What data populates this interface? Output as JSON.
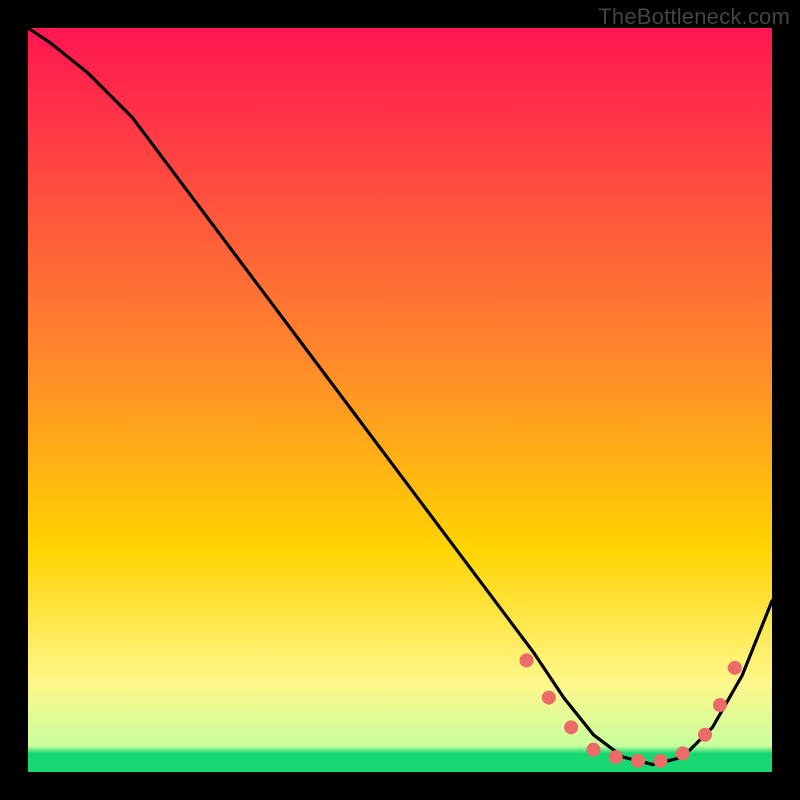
{
  "watermark": "TheBottleneck.com",
  "colors": {
    "frame": "#000000",
    "curve": "#000000",
    "dots": "#ec6b66",
    "bottom_band": "#17d773",
    "grad_top": "#ff1551",
    "grad_mid": "#ffd400",
    "grad_low": "#fff78a"
  },
  "chart_data": {
    "type": "line",
    "title": "",
    "xlabel": "",
    "ylabel": "",
    "xlim": [
      0,
      100
    ],
    "ylim": [
      0,
      100
    ],
    "grid": false,
    "legend": false,
    "series": [
      {
        "name": "curve",
        "x": [
          0,
          3,
          8,
          14,
          20,
          26,
          32,
          38,
          44,
          50,
          56,
          62,
          68,
          72,
          76,
          80,
          84,
          88,
          92,
          96,
          100
        ],
        "y": [
          100,
          98,
          94,
          88,
          80,
          72,
          64,
          56,
          48,
          40,
          32,
          24,
          16,
          10,
          5,
          2,
          1,
          2,
          6,
          13,
          23
        ]
      }
    ],
    "marker_points": {
      "name": "beads",
      "x": [
        67,
        70,
        73,
        76,
        79,
        82,
        85,
        88,
        91,
        93,
        95
      ],
      "y": [
        15,
        10,
        6,
        3,
        2,
        1.5,
        1.5,
        2.5,
        5,
        9,
        14
      ]
    },
    "background": {
      "type": "vertical-gradient",
      "stops": [
        {
          "pos": 0.0,
          "color": "#ff1551"
        },
        {
          "pos": 0.45,
          "color": "#ff8a2a"
        },
        {
          "pos": 0.7,
          "color": "#ffd400"
        },
        {
          "pos": 0.88,
          "color": "#fff78a"
        },
        {
          "pos": 0.965,
          "color": "#c9ff9e"
        },
        {
          "pos": 0.975,
          "color": "#17d773"
        },
        {
          "pos": 1.0,
          "color": "#17d773"
        }
      ]
    }
  }
}
